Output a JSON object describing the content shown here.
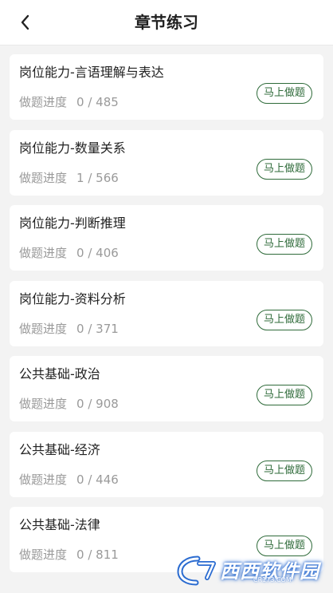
{
  "header": {
    "title": "章节练习",
    "back_icon": "chevron-left-icon"
  },
  "progress_label": "做题进度",
  "start_button_label": "马上做题",
  "chapters": [
    {
      "title": "岗位能力-言语理解与表达",
      "progress": "0 / 485"
    },
    {
      "title": "岗位能力-数量关系",
      "progress": "1 / 566"
    },
    {
      "title": "岗位能力-判断推理",
      "progress": "0 / 406"
    },
    {
      "title": "岗位能力-资料分析",
      "progress": "0 / 371"
    },
    {
      "title": "公共基础-政治",
      "progress": "0 / 908"
    },
    {
      "title": "公共基础-经济",
      "progress": "0 / 446"
    },
    {
      "title": "公共基础-法律",
      "progress": "0 / 811"
    }
  ],
  "watermark": {
    "text": "西西软件园",
    "url": "CR173.COM"
  },
  "colors": {
    "accent": "#2f6b3a",
    "background": "#f3f3f3",
    "card": "#ffffff",
    "muted_text": "#9a9a9a"
  }
}
